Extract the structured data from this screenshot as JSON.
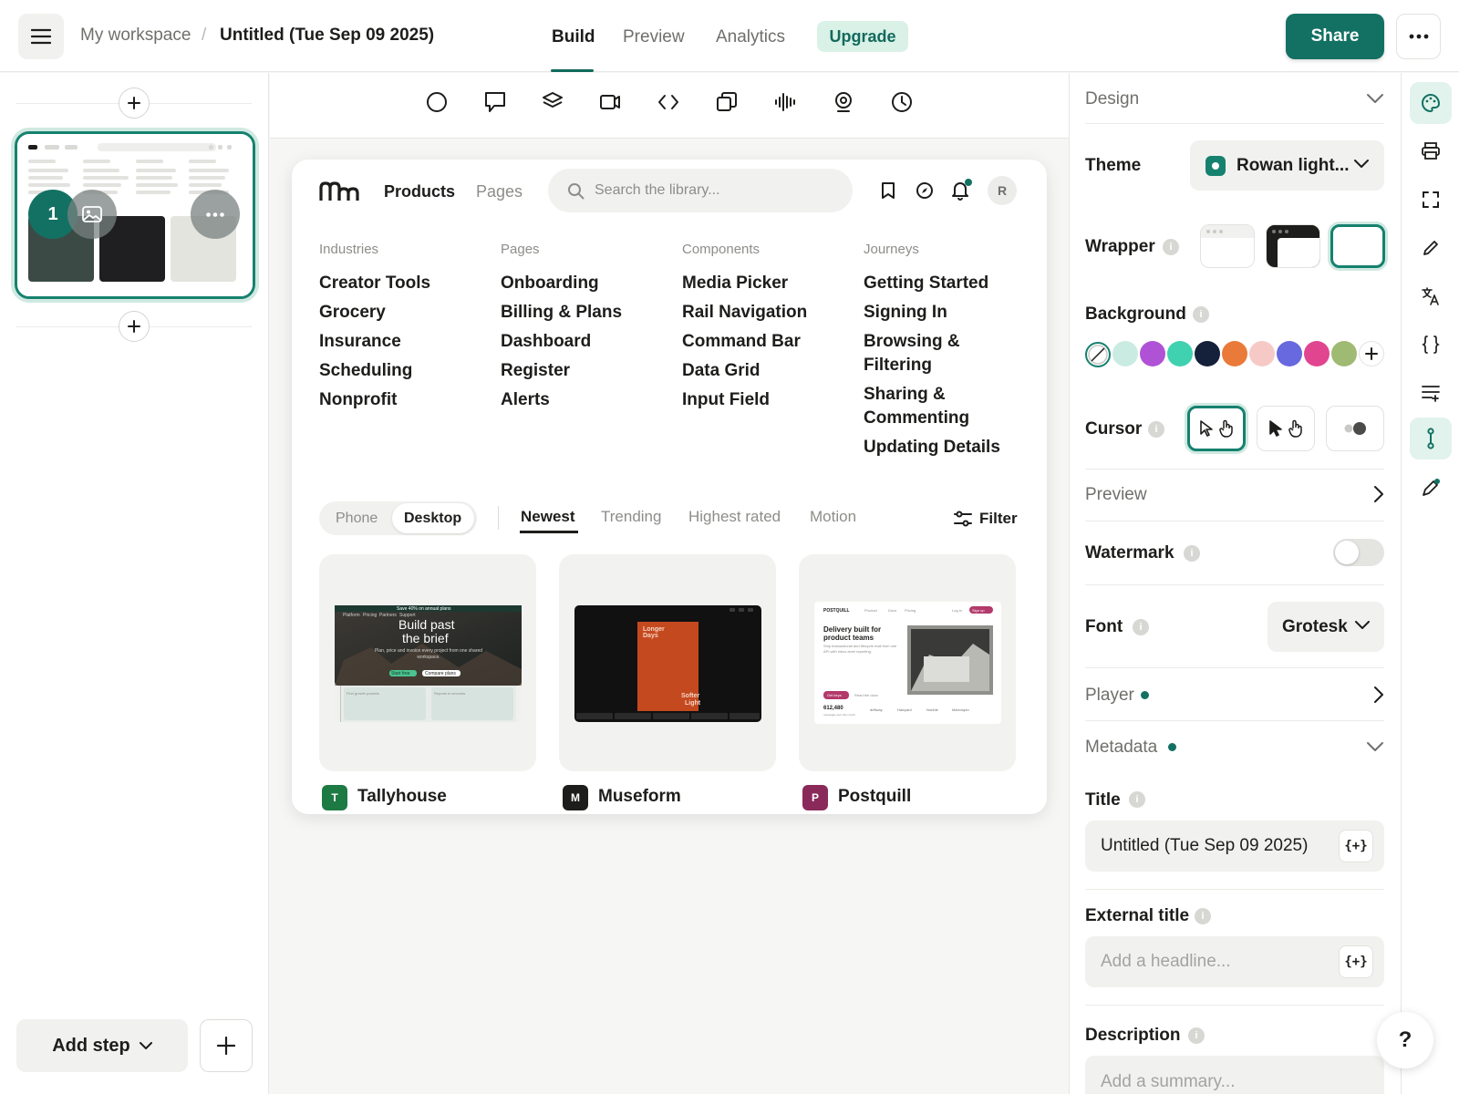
{
  "topbar": {
    "workspace": "My workspace",
    "separator": "/",
    "doc_title": "Untitled (Tue Sep 09 2025)",
    "tabs": [
      "Build",
      "Preview",
      "Analytics"
    ],
    "upgrade": "Upgrade",
    "share": "Share"
  },
  "left": {
    "step_number": "1",
    "add_step": "Add step"
  },
  "preview": {
    "nav": [
      "Products",
      "Pages"
    ],
    "search_placeholder": "Search the library...",
    "avatar": "R",
    "columns": [
      {
        "head": "Industries",
        "items": [
          "Creator Tools",
          "Grocery",
          "Insurance",
          "Scheduling",
          "Nonprofit"
        ]
      },
      {
        "head": "Pages",
        "items": [
          "Onboarding",
          "Billing & Plans",
          "Dashboard",
          "Register",
          "Alerts"
        ]
      },
      {
        "head": "Components",
        "items": [
          "Media Picker",
          "Rail Navigation",
          "Command Bar",
          "Data Grid",
          "Input Field"
        ]
      },
      {
        "head": "Journeys",
        "items": [
          "Getting Started",
          "Signing In",
          "Browsing &",
          "Filtering",
          "Sharing &",
          "Commenting",
          "Updating Details"
        ]
      }
    ],
    "device": [
      "Phone",
      "Desktop"
    ],
    "sort": [
      "Newest",
      "Trending",
      "Highest rated",
      "Motion"
    ],
    "filter": "Filter",
    "apps": [
      {
        "badge": "T",
        "name": "Tallyhouse",
        "color": "#1e7a43"
      },
      {
        "badge": "M",
        "name": "Museform",
        "color": "#1d1d1b"
      },
      {
        "badge": "P",
        "name": "Postquill",
        "color": "#8a2a5a"
      }
    ],
    "thumb1": {
      "banner": "Save 40% on annual plans",
      "headline_a": "Build past",
      "headline_b": "the brief",
      "btn_a": "Start free",
      "btn_b": "Compare plans",
      "nav_links": [
        "Platform",
        "Pricing",
        "Partners",
        "Support"
      ],
      "sub": "Plan, price and invoice every project from one shared workspace.",
      "card_a": "Find growth pockets",
      "card_b": "Reports in seconds"
    },
    "thumb2": {
      "line_a": "Longer",
      "line_b": "Days",
      "line_c": "Softer",
      "line_d": "Light"
    },
    "thumb3": {
      "brand": "POSTQUILL",
      "nav_links": [
        "Product",
        "Docs",
        "Pricing"
      ],
      "login": "Log in",
      "signup": "Sign up",
      "headline_a": "Delivery built for",
      "headline_b": "product teams",
      "sub": "Ship transactional and lifecycle mail from one API with inbox-level reporting.",
      "btn": "Get keys",
      "docs": "Read the docs",
      "stat": "612,480",
      "stat_label": "messages sent this month",
      "logos": [
        "driftway",
        "Halcyard",
        "Northle",
        "Marrowpin"
      ]
    }
  },
  "right": {
    "design": "Design",
    "theme_label": "Theme",
    "theme_value": "Rowan light...",
    "wrapper": "Wrapper",
    "background": "Background",
    "cursor": "Cursor",
    "preview": "Preview",
    "watermark": "Watermark",
    "font_label": "Font",
    "font_value": "Grotesk",
    "player": "Player",
    "metadata": "Metadata",
    "title_label": "Title",
    "title_value": "Untitled (Tue Sep 09 2025)",
    "external_title": "External title",
    "external_placeholder": "Add a headline...",
    "description": "Description",
    "description_placeholder": "Add a summary...",
    "var_button": "{+}",
    "help": "?",
    "info": "i",
    "swatches": [
      "#c9ebe2",
      "#b052d6",
      "#3fd1b0",
      "#15213b",
      "#ea7a3a",
      "#f7c9c6",
      "#6868df",
      "#e1458f",
      "#9fba73"
    ]
  }
}
